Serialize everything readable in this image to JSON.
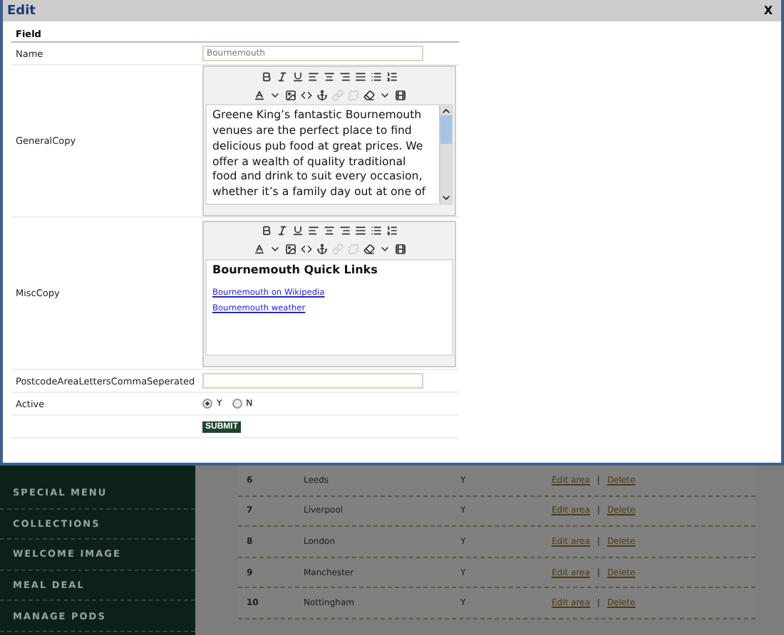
{
  "dialog": {
    "title": "Edit",
    "close": "X",
    "header": "Field",
    "fields": [
      {
        "kind": "text",
        "label": "Name",
        "value": "Bournemouth"
      },
      {
        "kind": "editor",
        "label": "GeneralCopy",
        "link_tools_disabled": true,
        "scrollbar": true,
        "paragraph": "Greene King’s fantastic Bournemouth venues are the perfect place to find delicious pub food at great prices. We offer a wealth of quality traditional food and drink to suit every occasion, whether it’s a family day out at one of"
      },
      {
        "kind": "editor",
        "label": "MiscCopy",
        "link_tools_disabled": true,
        "scrollbar": false,
        "heading": "Bournemouth Quick Links",
        "links": [
          "Bournemouth on Wikipedia",
          "Bournemouth weather"
        ]
      },
      {
        "kind": "text",
        "label": "PostcodeAreaLettersCommaSeperated"
      },
      {
        "kind": "radio",
        "label": "Active",
        "options": [
          {
            "label": "Y",
            "selected": true
          },
          {
            "label": "N",
            "selected": false
          }
        ]
      }
    ],
    "submit": "SUBMIT"
  },
  "sidebar": {
    "items": [
      "SPECIAL MENU",
      "COLLECTIONS",
      "WELCOME IMAGE",
      "MEAL DEAL",
      "MANAGE PODS"
    ]
  },
  "table": {
    "rows": [
      {
        "id": "6",
        "area": "Leeds",
        "active": "Y",
        "edit": "Edit area",
        "separator": "|",
        "delete": "Delete"
      },
      {
        "id": "7",
        "area": "Liverpool",
        "active": "Y",
        "edit": "Edit area",
        "separator": "|",
        "delete": "Delete"
      },
      {
        "id": "8",
        "area": "London",
        "active": "Y",
        "edit": "Edit area",
        "separator": "|",
        "delete": "Delete"
      },
      {
        "id": "9",
        "area": "Manchester",
        "active": "Y",
        "edit": "Edit area",
        "separator": "|",
        "delete": "Delete"
      },
      {
        "id": "10",
        "area": "Nottingham",
        "active": "Y",
        "edit": "Edit area",
        "separator": "|",
        "delete": "Delete"
      }
    ]
  }
}
